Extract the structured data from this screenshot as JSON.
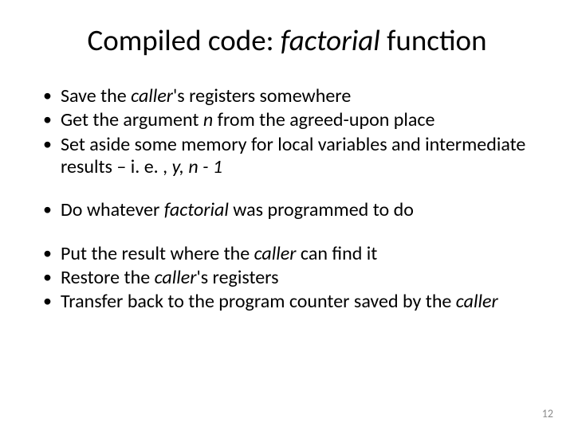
{
  "title": {
    "pre": "Compiled code: ",
    "fn": "factorial",
    "post": " function"
  },
  "g1": {
    "b1a": "Save the ",
    "b1b": "caller",
    "b1c": "'s registers somewhere",
    "b2a": "Get the argument ",
    "b2b": "n",
    "b2c": " from the agreed-upon place",
    "b3a": "Set aside some memory for local variables and intermediate results – i. e. , ",
    "b3b": "y, n - 1"
  },
  "g2": {
    "b1a": "Do whatever ",
    "b1b": "factorial",
    "b1c": " was programmed to do"
  },
  "g3": {
    "b1a": "Put the result where the ",
    "b1b": "caller",
    "b1c": " can find it",
    "b2a": "Restore the ",
    "b2b": "caller",
    "b2c": "'s registers",
    "b3a": "Transfer back to the program counter saved by the ",
    "b3b": "caller"
  },
  "page_number": "12"
}
